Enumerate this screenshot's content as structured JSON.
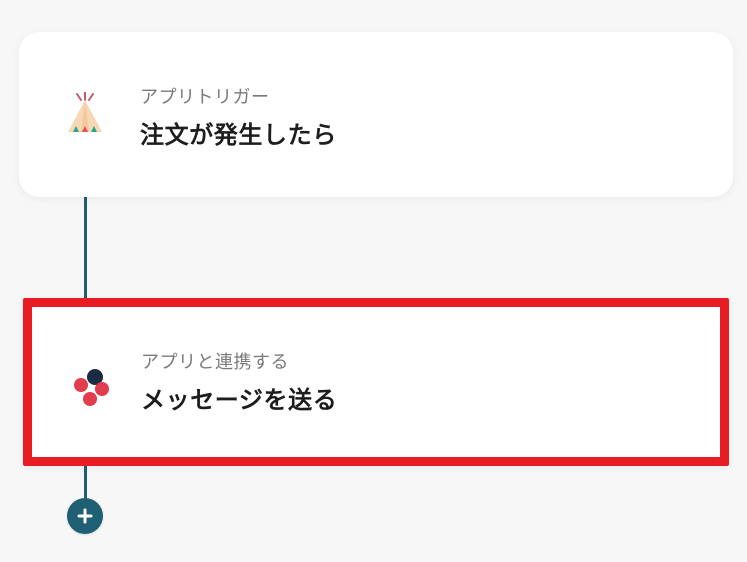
{
  "flow": {
    "trigger": {
      "subtitle": "アプリトリガー",
      "title": "注文が発生したら",
      "icon": "teepee-icon"
    },
    "action": {
      "subtitle": "アプリと連携する",
      "title": "メッセージを送る",
      "icon": "chatwork-icon"
    },
    "add_step_icon": "plus-icon"
  },
  "colors": {
    "connector": "#1f5f73",
    "highlight": "#e81c23",
    "trigger_icon_fill": "#f8d7b4",
    "action_icon_red": "#e23d4d",
    "action_icon_dark": "#1b2b43"
  }
}
